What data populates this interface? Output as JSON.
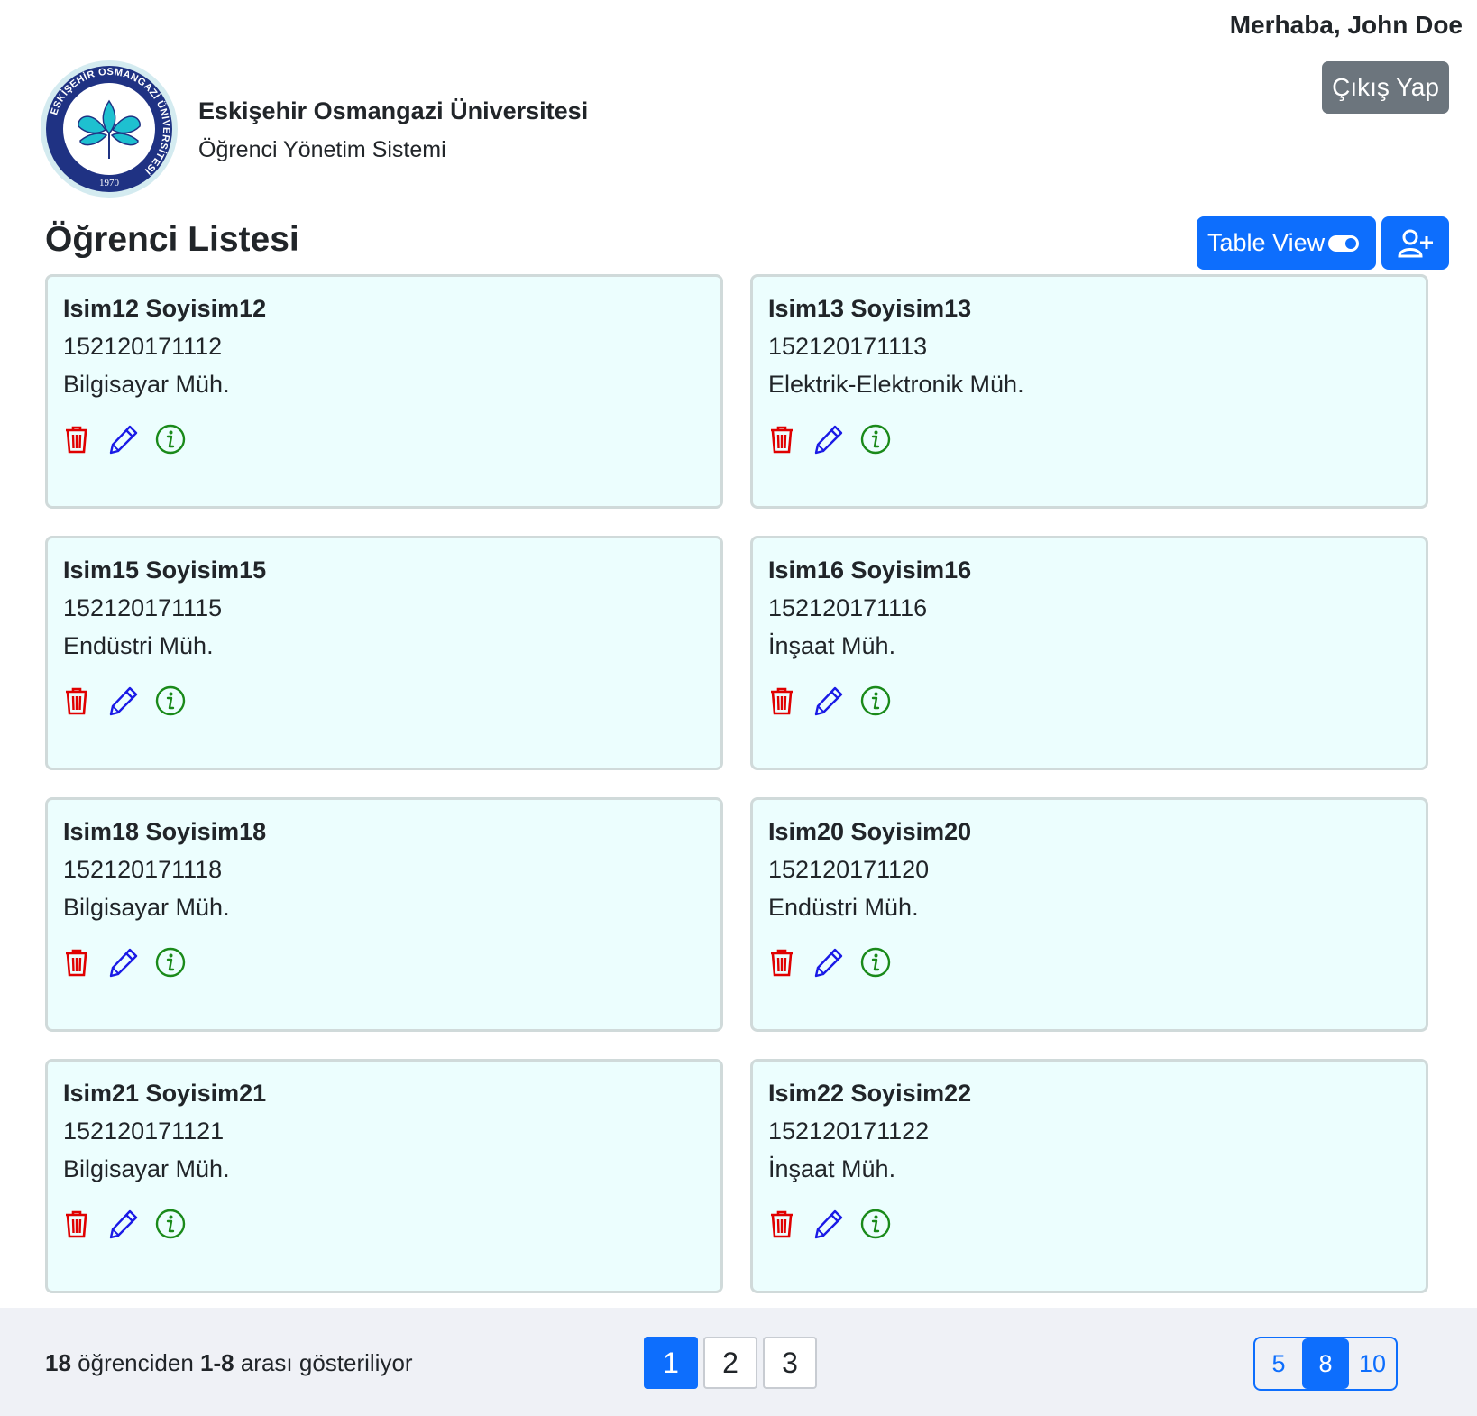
{
  "header": {
    "greeting": "Merhaba, John Doe",
    "logout_label": "Çıkış Yap",
    "university_name": "Eskişehir Osmangazi Üniversitesi",
    "system_name": "Öğrenci Yönetim Sistemi",
    "logo": {
      "ring_text": "ESKİŞEHİR OSMANGAZİ ÜNİVERSİTESİ",
      "year": "1970"
    }
  },
  "main": {
    "title": "Öğrenci Listesi",
    "view_toggle_label": "Table View",
    "add_icon": "user-plus-icon"
  },
  "students": [
    {
      "name": "Isim12 Soyisim12",
      "number": "152120171112",
      "department": "Bilgisayar Müh."
    },
    {
      "name": "Isim13 Soyisim13",
      "number": "152120171113",
      "department": "Elektrik-Elektronik Müh."
    },
    {
      "name": "Isim15 Soyisim15",
      "number": "152120171115",
      "department": "Endüstri Müh."
    },
    {
      "name": "Isim16 Soyisim16",
      "number": "152120171116",
      "department": "İnşaat Müh."
    },
    {
      "name": "Isim18 Soyisim18",
      "number": "152120171118",
      "department": "Bilgisayar Müh."
    },
    {
      "name": "Isim20 Soyisim20",
      "number": "152120171120",
      "department": "Endüstri Müh."
    },
    {
      "name": "Isim21 Soyisim21",
      "number": "152120171121",
      "department": "Bilgisayar Müh."
    },
    {
      "name": "Isim22 Soyisim22",
      "number": "152120171122",
      "department": "İnşaat Müh."
    }
  ],
  "card_actions": {
    "delete_icon": "trash-icon",
    "edit_icon": "pencil-icon",
    "info_icon": "info-circle-icon"
  },
  "footer": {
    "total": "18",
    "summary_mid": " öğrenciden ",
    "range": "1-8",
    "summary_end": " arası gösteriliyor",
    "pages": [
      "1",
      "2",
      "3"
    ],
    "active_page": "1",
    "page_sizes": [
      "5",
      "8",
      "10"
    ],
    "active_page_size": "8"
  },
  "colors": {
    "primary": "#0d6efd",
    "secondary": "#6c757d",
    "card_bg": "#ecfefe",
    "delete": "#e00000",
    "edit": "#1a1ae6",
    "info": "#1a8a1a"
  }
}
